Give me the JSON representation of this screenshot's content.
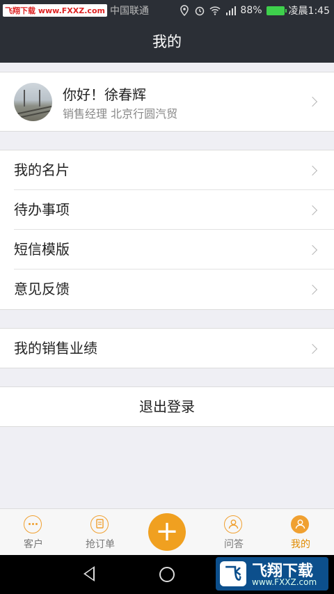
{
  "status_bar": {
    "watermark": "飞翔下载 www.FXXZ.com",
    "carrier": "中国联通",
    "battery": "88%",
    "time": "凌晨1:45"
  },
  "header": {
    "title": "我的"
  },
  "profile": {
    "greeting": "你好！徐春辉",
    "subtitle": "销售经理 北京行圆汽贸"
  },
  "menu": {
    "items": [
      {
        "label": "我的名片"
      },
      {
        "label": "待办事项"
      },
      {
        "label": "短信模版"
      },
      {
        "label": "意见反馈"
      }
    ],
    "sales": {
      "label": "我的销售业绩"
    },
    "logout": {
      "label": "退出登录"
    }
  },
  "tabs": [
    {
      "label": "客户",
      "icon": "ellipsis-circle-icon"
    },
    {
      "label": "抢订单",
      "icon": "document-circle-icon"
    },
    {
      "label": "",
      "icon": "plus-icon"
    },
    {
      "label": "问答",
      "icon": "person-outline-icon"
    },
    {
      "label": "我的",
      "icon": "person-filled-icon",
      "active": true
    }
  ],
  "watermark_logo": {
    "brand": "飞翔下载",
    "url": "www.FXXZ.com"
  },
  "colors": {
    "accent": "#f0a020",
    "header_bg": "#2b2f36"
  }
}
